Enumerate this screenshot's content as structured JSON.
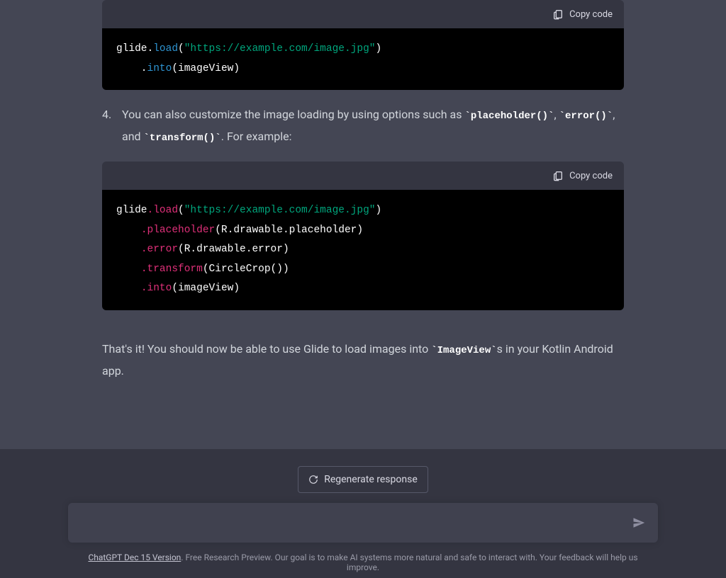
{
  "copy_label": "Copy code",
  "code1": {
    "prefix": "glide.",
    "load": "load",
    "str": "\"https://example.com/image.jpg\"",
    "into_indent": "    .",
    "into": "into",
    "into_args": "(imageView)"
  },
  "step4": {
    "number": "4.",
    "text_before": "You can also customize the image loading by using options such as ",
    "c_placeholder": "`placeholder()`",
    "comma1": ", ",
    "c_error": "`error()`",
    "and": ", and ",
    "c_transform": "`transform()`",
    "tail": ". For example:"
  },
  "code2": {
    "line1_pre": "glide",
    "dot": ".",
    "load": "load",
    "load_open": "(",
    "str": "\"https://example.com/image.jpg\"",
    "load_close": ")",
    "indent": "    ",
    "ph": "placeholder",
    "ph_args": "(R.drawable.placeholder)",
    "err": "error",
    "err_args": "(R.drawable.error)",
    "tr": "transform",
    "tr_args": "(CircleCrop())",
    "into": "into",
    "into_args": "(imageView)"
  },
  "closing": {
    "before": "That's it! You should now be able to use Glide to load images into ",
    "code": "`ImageView`",
    "after": "s in your Kotlin Android app."
  },
  "regen": "Regenerate response",
  "input_placeholder": "",
  "footer": {
    "link": "ChatGPT Dec 15 Version",
    "rest": ". Free Research Preview. Our goal is to make AI systems more natural and safe to interact with. Your feedback will help us improve."
  }
}
